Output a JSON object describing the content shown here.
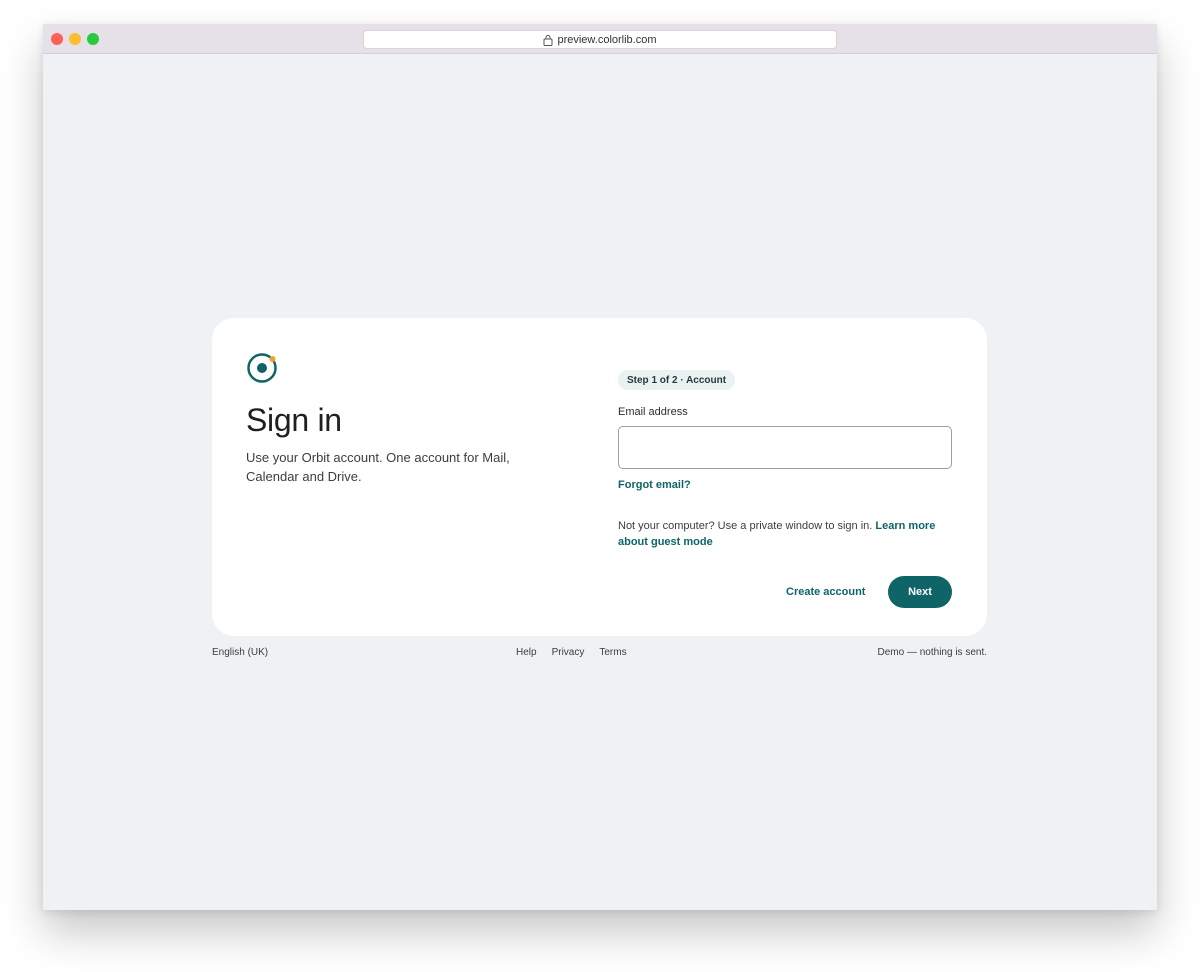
{
  "browser": {
    "url": "preview.colorlib.com",
    "icons": [
      "lock-icon"
    ],
    "window_controls": [
      "close",
      "minimize",
      "maximize"
    ]
  },
  "card": {
    "logo": "orbit-logo-icon",
    "title": "Sign in",
    "subtitle": "Use your Orbit account. One account for Mail, Calendar and Drive.",
    "step_badge": "Step 1 of 2 · Account",
    "email_label": "Email address",
    "email_value": "",
    "forgot_email": "Forgot email?",
    "guest_text": "Not your computer? Use a private window to sign in.",
    "guest_link": "Learn more about guest mode",
    "create_account": "Create account",
    "next": "Next"
  },
  "footer": {
    "language": "English (UK)",
    "links": [
      "Help",
      "Privacy",
      "Terms"
    ],
    "note": "Demo — nothing is sent."
  },
  "colors": {
    "accent": "#0f6468",
    "accent_dot": "#f2a22b",
    "page_bg": "#eff2f5",
    "card_bg": "#ffffff"
  }
}
